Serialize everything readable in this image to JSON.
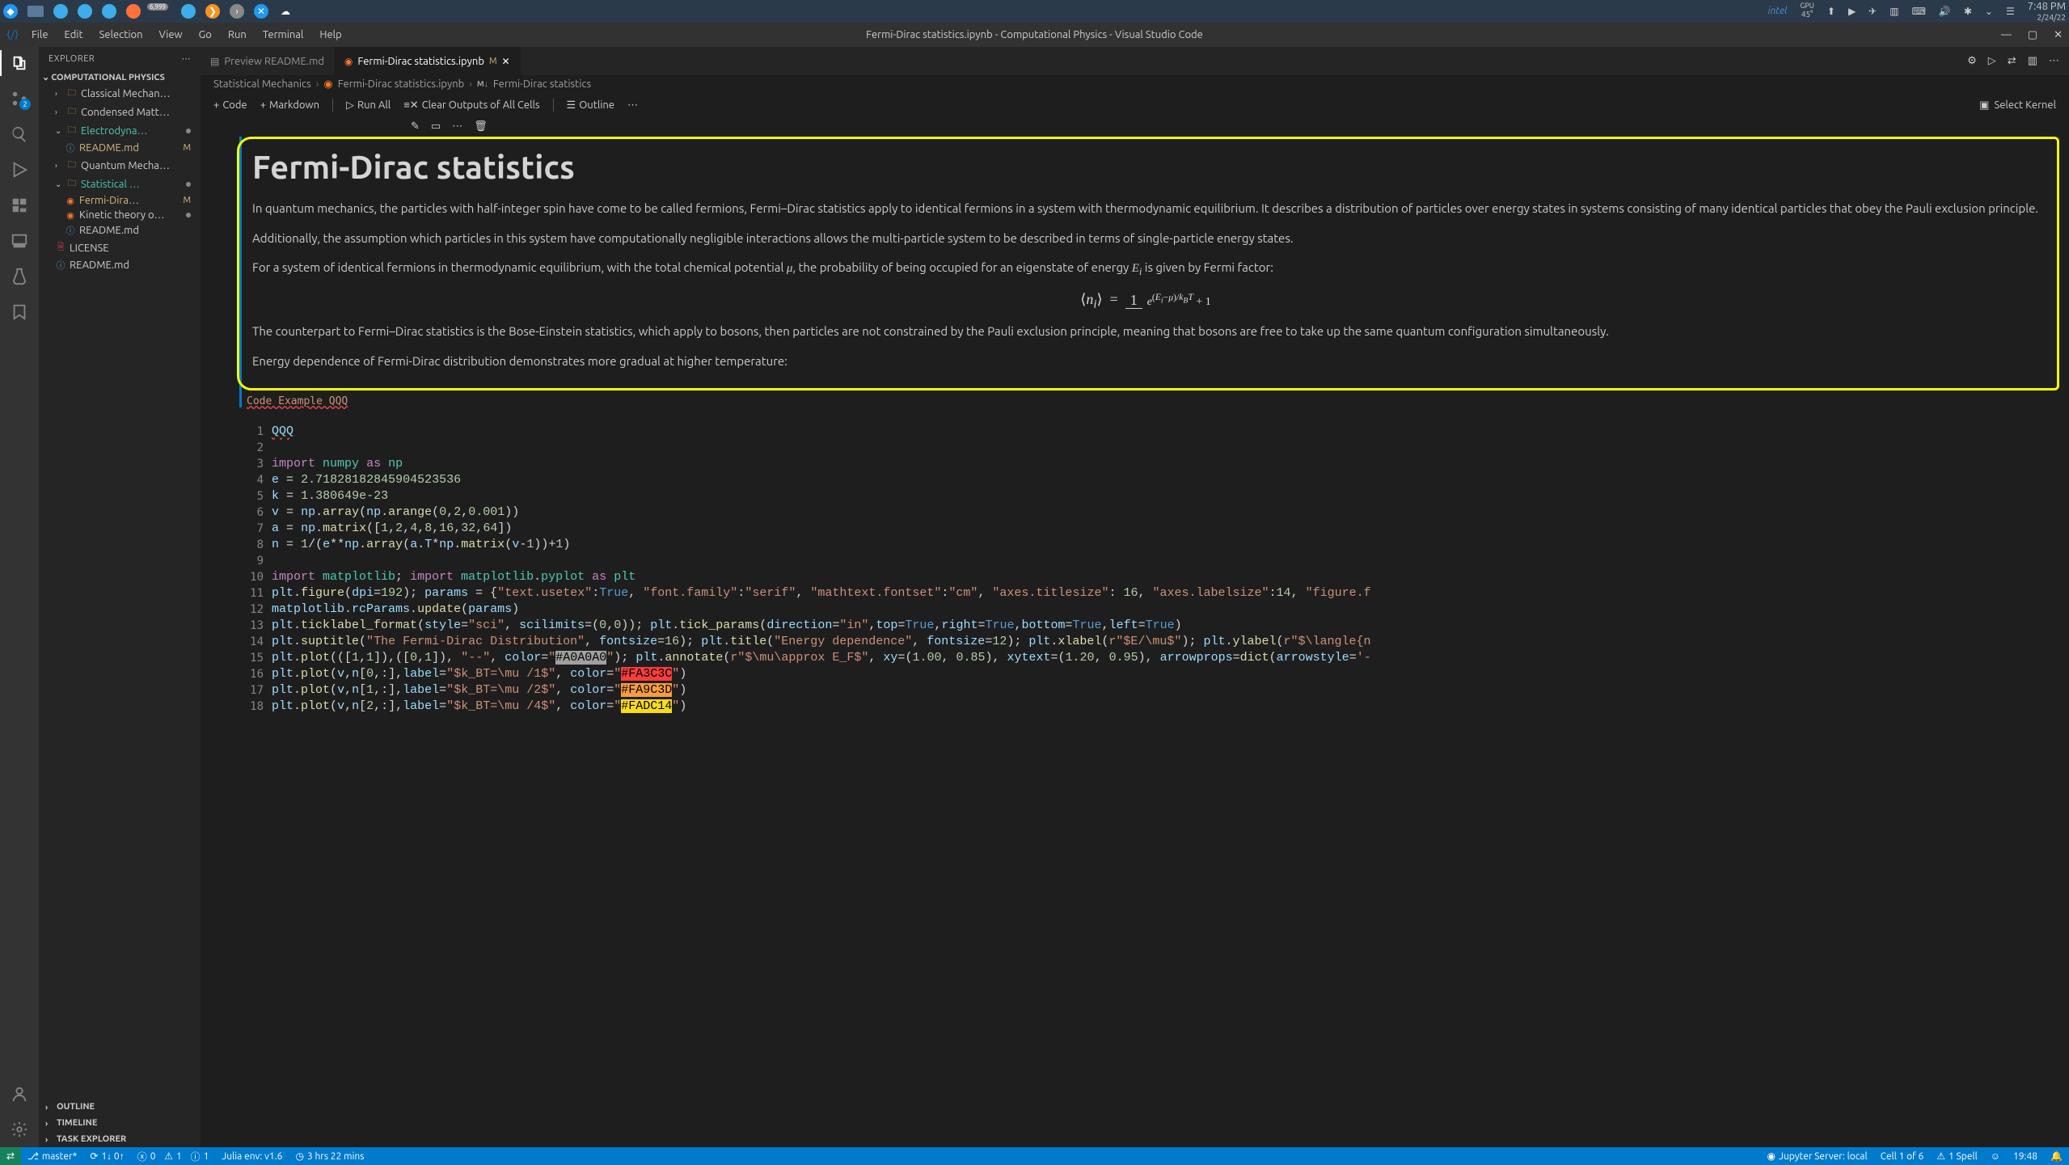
{
  "taskbar": {
    "gpu_temp_label": "GPU",
    "gpu_temp_value": "45°",
    "clock_time": "7:48 PM",
    "clock_date": "2/24/22",
    "intel": "intel"
  },
  "window": {
    "title": "Fermi-Dirac statistics.ipynb - Computational Physics - Visual Studio Code",
    "menus": [
      "File",
      "Edit",
      "Selection",
      "View",
      "Go",
      "Run",
      "Terminal",
      "Help"
    ]
  },
  "sidebar": {
    "title": "EXPLORER",
    "section": "COMPUTATIONAL PHYSICS",
    "tree": {
      "classical": "Classical Mechan…",
      "condensed": "Condensed Matt…",
      "electro": "Electrodyna…",
      "readme1": "README.md",
      "quantum": "Quantum Mecha…",
      "stat": "Statistical …",
      "fermi": "Fermi-Dira…",
      "kinetic": "Kinetic theory o…",
      "readme2": "README.md",
      "license": "LICENSE",
      "readme3": "README.md"
    },
    "outline": "OUTLINE",
    "timeline": "TIMELINE",
    "task_explorer": "TASK EXPLORER"
  },
  "scm_badge": "2",
  "tabs": {
    "preview": "Preview README.md",
    "fermi": "Fermi-Dirac statistics.ipynb",
    "fermi_mod": "M"
  },
  "tab_actions": {},
  "breadcrumbs": {
    "folder": "Statistical Mechanics",
    "file": "Fermi-Dirac statistics.ipynb",
    "cell_prefix": "M↓",
    "cell": "Fermi-Dirac statistics"
  },
  "nb_toolbar": {
    "code": "Code",
    "markdown": "Markdown",
    "run_all": "Run All",
    "clear": "Clear Outputs of All Cells",
    "outline": "Outline",
    "kernel": "Select Kernel"
  },
  "markdown": {
    "h1": "Fermi-Dirac statistics",
    "p1": "In quantum mechanics, the particles with half-integer spin have come to be called fermions, Fermi–Dirac statistics apply to identical fermions in a system with thermodynamic equilibrium. It describes a distribution of particles over energy states in systems consisting of many identical particles that obey the Pauli exclusion principle.",
    "p2": "Additionally, the assumption which particles in this system have computationally negligible interactions allows the multi-particle system to be described in terms of single-particle energy states.",
    "p3a": "For a system of identical fermions in thermodynamic equilibrium, with the total chemical potential ",
    "p3b": ", the probability of being occupied for an eigenstate of energy ",
    "p3c": " is given by Fermi factor:",
    "p4": "The counterpart to Fermi–Dirac statistics is the Bose-Einstein statistics, which apply to bosons, then particles are not constrained by the Pauli exclusion principle, meaning that bosons are free to take up the same quantum configuration simultaneously.",
    "p5": "Energy dependence of Fermi-Dirac distribution demonstrates more gradual at higher temperature:",
    "code_label": "Code Example QQQ"
  },
  "code": {
    "lines": [
      "QQQ",
      "",
      "import numpy as np",
      "e = 2.71828182845904523536",
      "k = 1.380649e-23",
      "v = np.array(np.arange(0,2,0.001))",
      "a = np.matrix([1,2,4,8,16,32,64])",
      "n = 1/(e**np.array(a.T*np.matrix(v-1))+1)",
      "",
      "import matplotlib; import matplotlib.pyplot as plt",
      "plt.figure(dpi=192); params = {\"text.usetex\":True, \"font.family\":\"serif\", \"mathtext.fontset\":\"cm\", \"axes.titlesize\": 16, \"axes.labelsize\":14, \"figure.f",
      "matplotlib.rcParams.update(params)",
      "plt.ticklabel_format(style=\"sci\", scilimits=(0,0)); plt.tick_params(direction=\"in\",top=True,right=True,bottom=True,left=True)",
      "plt.suptitle(\"The Fermi-Dirac Distribution\", fontsize=16); plt.title(\"Energy dependence\", fontsize=12); plt.xlabel(r\"$E/\\mu$\"); plt.ylabel(r\"$\\langle{n",
      "plt.plot(([1,1]),([0,1]), \"--\", color=\"#A0A0A0\"); plt.annotate(r\"$\\mu\\approx E_F$\", xy=(1.00, 0.85), xytext=(1.20, 0.95), arrowprops=dict(arrowstyle='-",
      "plt.plot(v,n[0,:],label=\"$k_BT=\\mu /1$\", color=\"#FA3C3C\")",
      "plt.plot(v,n[1,:],label=\"$k_BT=\\mu /2$\", color=\"#FA9C3D\")",
      "plt.plot(v,n[2,:],label=\"$k_BT=\\mu /4$\", color=\"#FADC14\")"
    ]
  },
  "statusbar": {
    "branch": "master*",
    "sync": "1↓ 0↑",
    "errors": "0",
    "warnings": "1",
    "info": "1",
    "julia": "Julia env: v1.6",
    "time": "3 hrs 22 mins",
    "jupyter": "Jupyter Server: local",
    "cell": "Cell 1 of 6",
    "spell": "1 Spell",
    "clock": "19:48"
  }
}
